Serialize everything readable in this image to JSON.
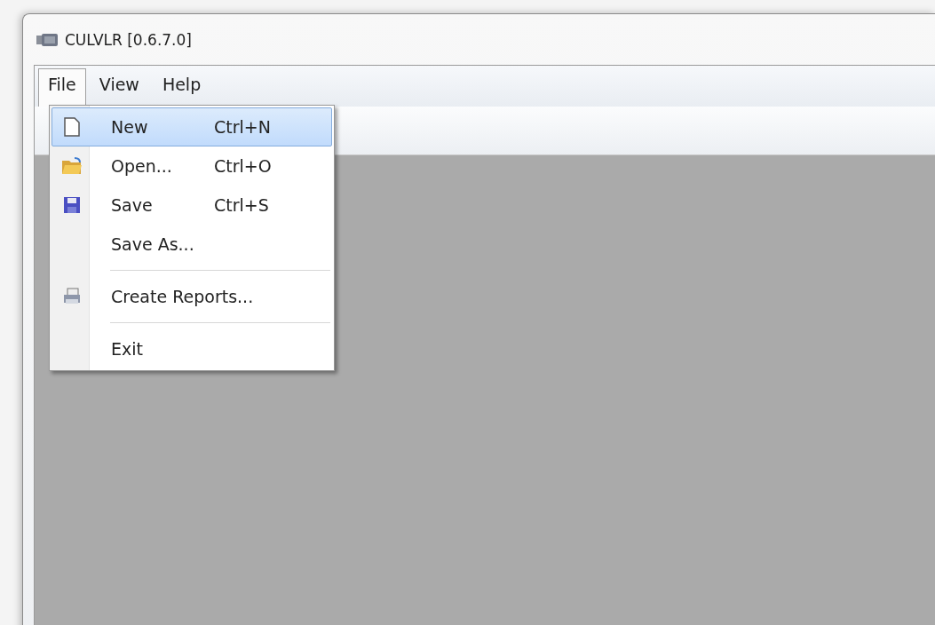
{
  "window": {
    "title": "CULVLR [0.6.7.0]"
  },
  "menu_bar": [
    {
      "label": "File",
      "selected": true
    },
    {
      "label": "View",
      "selected": false
    },
    {
      "label": "Help",
      "selected": false
    }
  ],
  "file_menu": [
    {
      "kind": "item",
      "label": "New",
      "shortcut": "Ctrl+N",
      "selected": true
    },
    {
      "kind": "item",
      "label": "Open...",
      "shortcut": "Ctrl+O",
      "selected": false
    },
    {
      "kind": "item",
      "label": "Save",
      "shortcut": "Ctrl+S",
      "selected": false
    },
    {
      "kind": "item",
      "label": "Save As...",
      "selected": false
    },
    {
      "kind": "separator"
    },
    {
      "kind": "item",
      "label": "Create Reports...",
      "selected": false
    },
    {
      "kind": "separator"
    },
    {
      "kind": "item",
      "label": "Exit",
      "selected": false
    }
  ]
}
